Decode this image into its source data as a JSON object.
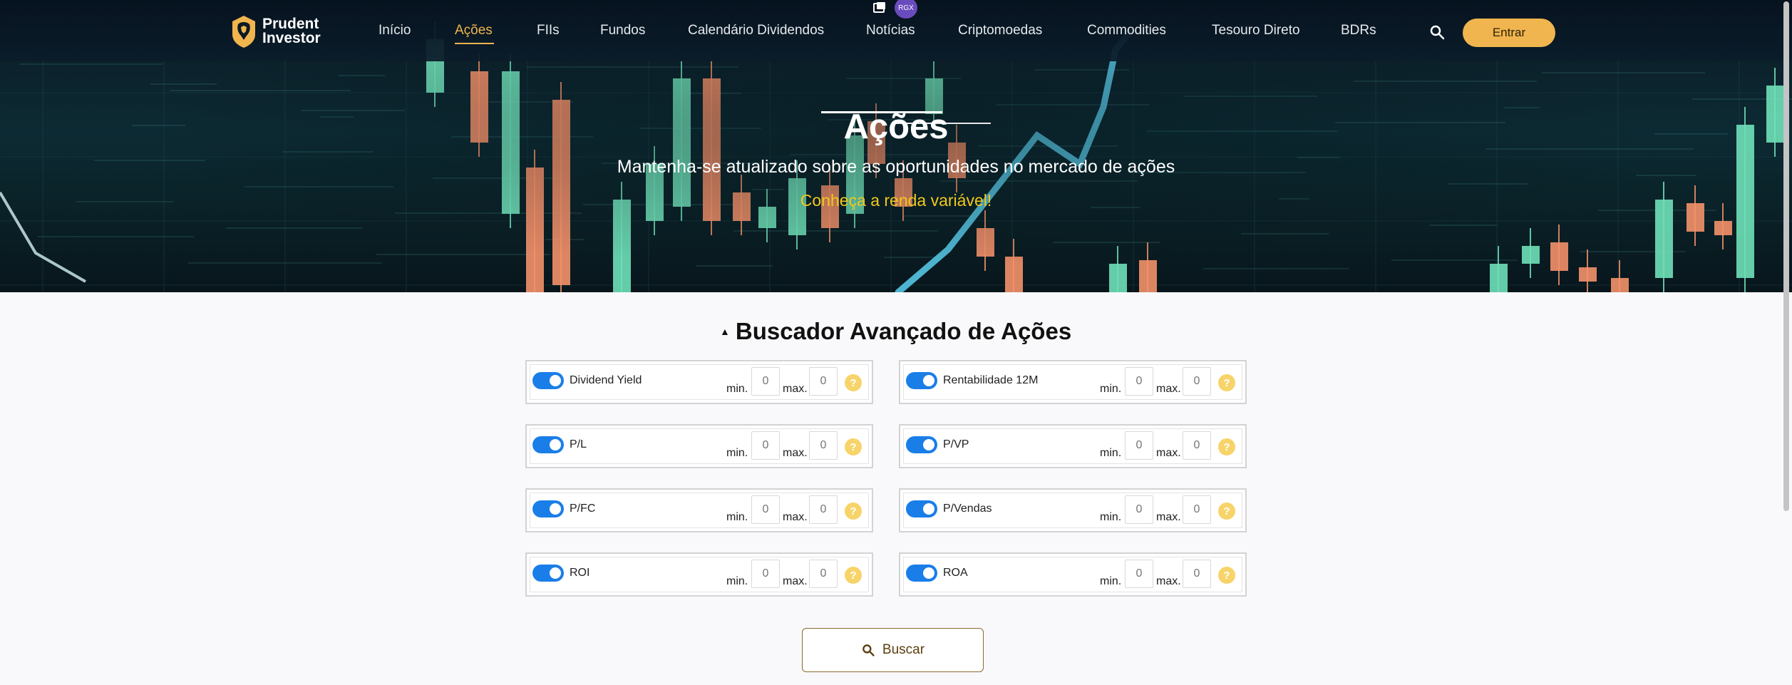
{
  "header": {
    "logo_text_line1": "Prudent",
    "logo_text_line2": "Investor",
    "nav": [
      {
        "label": "Início",
        "active": false
      },
      {
        "label": "Ações",
        "active": true
      },
      {
        "label": "FIIs",
        "active": false
      },
      {
        "label": "Fundos",
        "active": false
      },
      {
        "label": "Calendário Dividendos",
        "active": false
      },
      {
        "label": "Notícias",
        "active": false
      },
      {
        "label": "Criptomoedas",
        "active": false
      },
      {
        "label": "Commodities",
        "active": false
      },
      {
        "label": "Tesouro Direto",
        "active": false
      },
      {
        "label": "BDRs",
        "active": false
      }
    ],
    "login_label": "Entrar",
    "badge_text": "RGX",
    "icons": {
      "search": "search-icon",
      "screenshot": "screenshot-icon"
    }
  },
  "hero": {
    "title": "Ações",
    "subtitle": "Mantenha-se atualizado sobre as oportunidades no mercado de ações",
    "link": "Conheça a renda variável!"
  },
  "search": {
    "title": "Buscador Avançado de Ações",
    "min_label": "min.",
    "max_label": "max.",
    "help_label": "?",
    "filters": [
      {
        "label": "Dividend Yield",
        "enabled": true,
        "min_placeholder": "0",
        "max_placeholder": "0"
      },
      {
        "label": "Rentabilidade 12M",
        "enabled": true,
        "min_placeholder": "0",
        "max_placeholder": "0"
      },
      {
        "label": "P/L",
        "enabled": true,
        "min_placeholder": "0",
        "max_placeholder": "0"
      },
      {
        "label": "P/VP",
        "enabled": true,
        "min_placeholder": "0",
        "max_placeholder": "0"
      },
      {
        "label": "P/FC",
        "enabled": true,
        "min_placeholder": "0",
        "max_placeholder": "0"
      },
      {
        "label": "P/Vendas",
        "enabled": true,
        "min_placeholder": "0",
        "max_placeholder": "0"
      },
      {
        "label": "ROI",
        "enabled": true,
        "min_placeholder": "0",
        "max_placeholder": "0"
      },
      {
        "label": "ROA",
        "enabled": true,
        "min_placeholder": "0",
        "max_placeholder": "0"
      }
    ],
    "button_label": "Buscar"
  },
  "colors": {
    "accent": "#f0b54e",
    "link": "#f2c81c",
    "toggle": "#1a7ee8",
    "help": "#f7d46a",
    "candle_up": "#6fe0b8",
    "candle_down": "#f4916a"
  }
}
